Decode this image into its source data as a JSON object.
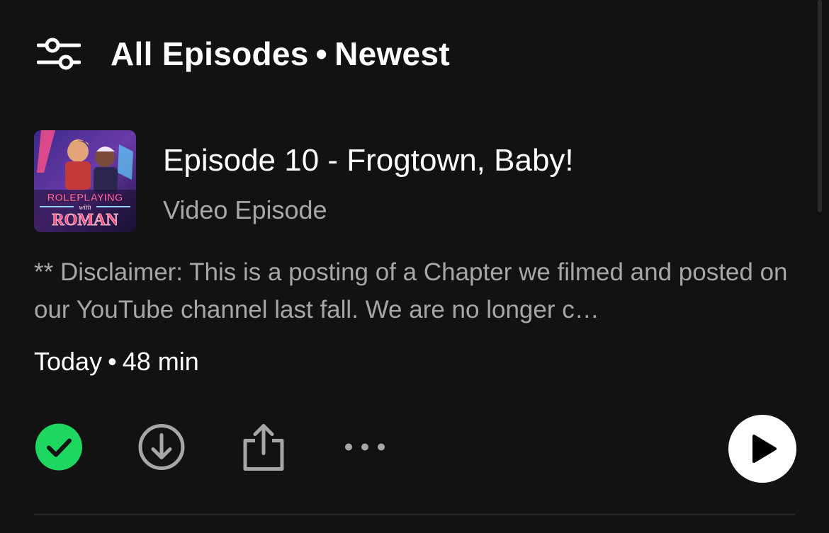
{
  "header": {
    "filter_icon": "filter-sliders-icon",
    "title_part1": "All Episodes",
    "separator": "•",
    "title_part2": "Newest"
  },
  "episode": {
    "title": "Episode 10 - Frogtown, Baby!",
    "type": "Video Episode",
    "cover_text_line1": "ROLEPLAYING",
    "cover_text_line2": "with",
    "cover_text_line3": "ROMAN",
    "description": "** Disclaimer: This is a posting of a Chapter we filmed and posted on our YouTube channel last fall. We are no longer c…",
    "date": "Today",
    "meta_separator": "•",
    "duration": "48 min"
  },
  "actions": {
    "added_icon": "check-circle-icon",
    "download_icon": "download-circle-icon",
    "share_icon": "share-icon",
    "more_icon": "more-horizontal-icon",
    "play_icon": "play-icon"
  },
  "colors": {
    "background": "#121212",
    "primary_text": "#ffffff",
    "secondary_text": "#a7a7a7",
    "accent_green": "#1ed760",
    "icon_gray": "#a7a7a7"
  }
}
